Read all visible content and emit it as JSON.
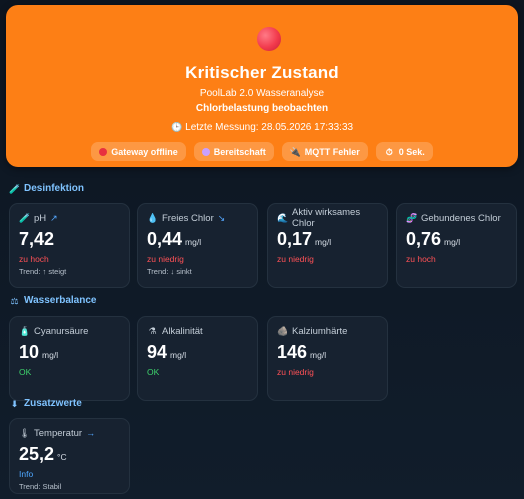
{
  "hero": {
    "title": "Kritischer Zustand",
    "subtitle": "PoolLab 2.0 Wasseranalyse",
    "warning": "Chlorbelastung beobachten",
    "last_measurement": "Letzte Messung: 28.05.2026 17:33:33",
    "pills": [
      {
        "label": "Gateway offline",
        "icon": "red-dot-icon",
        "color": "#e8313f"
      },
      {
        "label": "Bereitschaft",
        "icon": "purple-dot-icon",
        "color": "#c9a0ff"
      },
      {
        "label": "MQTT Fehler",
        "icon": "plug-icon"
      },
      {
        "label": "0 Sek.",
        "icon": "stopwatch-icon"
      }
    ],
    "color": "#fd7f15"
  },
  "sections": {
    "disinfection": "Desinfektion",
    "balance": "Wasserbalance",
    "extra": "Zusatzwerte"
  },
  "cards": {
    "ph": {
      "label": "pH",
      "trend_arrow": "↗",
      "value": "7,42",
      "unit": "",
      "state": "zu hoch",
      "trend": "Trend: ↑ steigt",
      "icon": "test-tube-icon"
    },
    "free_chlorine": {
      "label": "Freies Chlor",
      "trend_arrow": "↘",
      "value": "0,44",
      "unit": "mg/l",
      "state": "zu niedrig",
      "trend": "Trend: ↓ sinkt",
      "icon": "droplet-icon"
    },
    "active_chlorine": {
      "label": "Aktiv wirksames Chlor",
      "value": "0,17",
      "unit": "mg/l",
      "state": "zu niedrig",
      "icon": "wave-icon"
    },
    "bound_chlorine": {
      "label": "Gebundenes Chlor",
      "value": "0,76",
      "unit": "mg/l",
      "state": "zu hoch",
      "icon": "dna-icon"
    },
    "cyanuric": {
      "label": "Cyanursäure",
      "value": "10",
      "unit": "mg/l",
      "state": "OK",
      "icon": "bottle-icon"
    },
    "alkalinity": {
      "label": "Alkalinität",
      "value": "94",
      "unit": "mg/l",
      "state": "OK",
      "icon": "flask-icon"
    },
    "calcium": {
      "label": "Kalziumhärte",
      "value": "146",
      "unit": "mg/l",
      "state": "zu niedrig",
      "icon": "rock-icon"
    },
    "temperature": {
      "label": "Temperatur",
      "trend_arrow": "→",
      "value": "25,2",
      "unit": "°C",
      "state": "Info",
      "trend": "Trend: Stabil",
      "icon": "thermometer-icon"
    }
  },
  "colors": {
    "danger": "#ff5156",
    "ok": "#3ed36c",
    "info": "#4da6ff",
    "section": "#7fc3ff",
    "card": "#172230"
  }
}
